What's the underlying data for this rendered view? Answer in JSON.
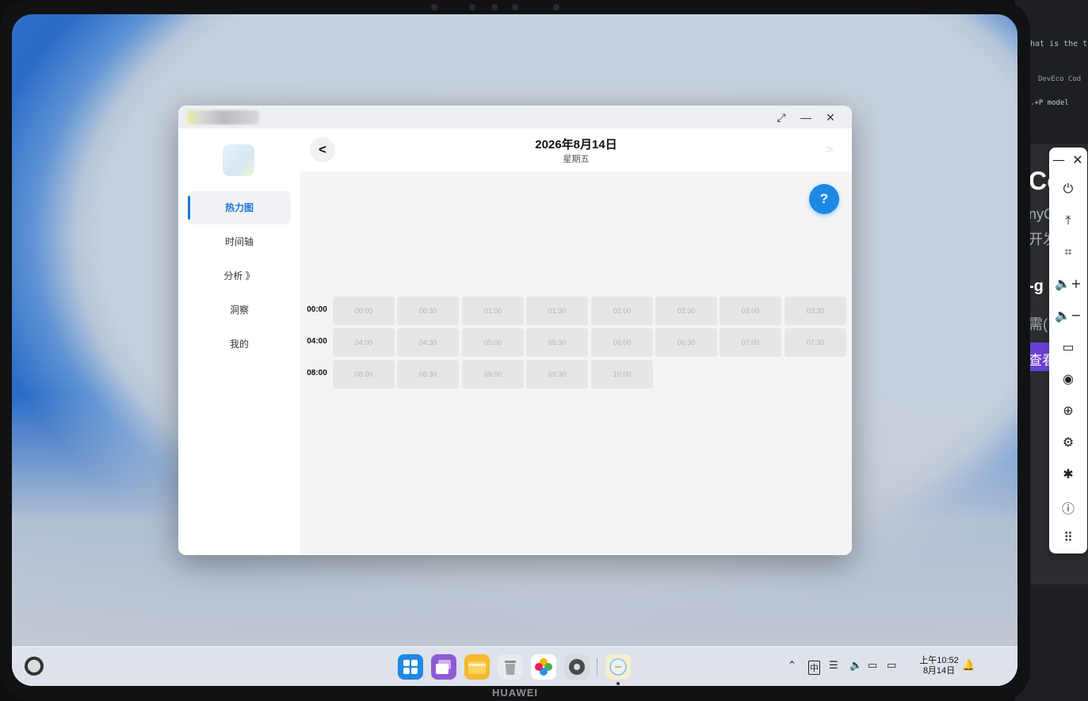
{
  "background_window": {
    "code_line": "hat is the t",
    "tab_label": "DevEco Cod",
    "model_label": ".+P model",
    "heading_fragment": "Co",
    "sub1": "nyC",
    "sub2": "开发",
    "heading2": "-g",
    "desc": "需(",
    "button_label": "查看"
  },
  "device": {
    "brand": "HUAWEI"
  },
  "window": {
    "controls": {
      "maximize": "⤢",
      "minimize": "—",
      "close": "✕"
    }
  },
  "sidebar": {
    "items": [
      {
        "label": "热力图",
        "active": true
      },
      {
        "label": "时间轴",
        "active": false
      },
      {
        "label": "分析 》",
        "active": false
      },
      {
        "label": "洞察",
        "active": false
      },
      {
        "label": "我的",
        "active": false
      }
    ]
  },
  "datebar": {
    "prev": "<",
    "next": ">",
    "date": "2026年8月14日",
    "weekday": "星期五"
  },
  "help": {
    "label": "?"
  },
  "heatmap": {
    "rows": [
      {
        "label": "00:00",
        "cells": [
          "00:00",
          "00:30",
          "01:00",
          "01:30",
          "02:00",
          "02:30",
          "03:00",
          "03:30"
        ]
      },
      {
        "label": "04:00",
        "cells": [
          "04:00",
          "04:30",
          "05:00",
          "05:30",
          "06:00",
          "06:30",
          "07:00",
          "07:30"
        ]
      },
      {
        "label": "08:00",
        "cells": [
          "08:00",
          "08:30",
          "09:00",
          "09:30",
          "10:00"
        ]
      }
    ]
  },
  "taskbar": {
    "dock_apps": [
      {
        "name": "app-center",
        "color": "#1e88e5"
      },
      {
        "name": "multi-window",
        "color": "#8e5bd6"
      },
      {
        "name": "files",
        "color": "#f5b92e"
      },
      {
        "name": "recycle-bin",
        "color": "#b9bcc1"
      },
      {
        "name": "gallery",
        "color": "#ffffff"
      },
      {
        "name": "settings",
        "color": "#4a4a4e"
      },
      {
        "name": "running-app",
        "color": "#f4efcf"
      }
    ],
    "tray": {
      "chevron": "⌃",
      "ime": "中",
      "clipboard": "☰",
      "volume": "🔈",
      "display": "▭",
      "battery": "▭",
      "bell": "🔔"
    },
    "clock_time": "上午10:52",
    "clock_date": "8月14日"
  },
  "control_bar": {
    "icons": [
      "minimize",
      "close",
      "power",
      "pin-top",
      "crop",
      "volume-up",
      "volume-down",
      "tag",
      "broadcast",
      "globe",
      "settings",
      "bug",
      "info",
      "keyboard"
    ],
    "glyphs": {
      "minimize": "—",
      "close": "✕",
      "power": "⏻",
      "pin-top": "⤒",
      "crop": "⌗",
      "volume-up": "🔈+",
      "volume-down": "🔈−",
      "tag": "▭",
      "broadcast": "◉",
      "globe": "⊕",
      "settings": "⚙",
      "bug": "✱",
      "info": "ⓘ",
      "keyboard": "⠿"
    }
  }
}
